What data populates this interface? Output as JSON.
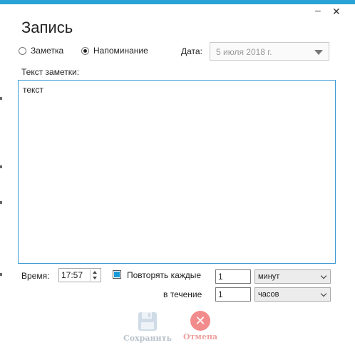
{
  "window": {
    "minimize_glyph": "–",
    "close_glyph": "✕"
  },
  "title": "Запись",
  "mode": {
    "note_label": "Заметка",
    "reminder_label": "Напоминание",
    "selected": "reminder"
  },
  "date": {
    "label": "Дата:",
    "value": "5 июля 2018 г."
  },
  "note": {
    "label": "Текст заметки:",
    "value": "текст"
  },
  "time": {
    "label": "Время:",
    "value": "17:57"
  },
  "repeat": {
    "checked": true,
    "label": "Повторять каждые",
    "every_value": "1",
    "every_unit": "минут",
    "during_label": "в течение",
    "during_value": "1",
    "during_unit": "часов"
  },
  "actions": {
    "save_label": "Сохранить",
    "cancel_label": "Отмена",
    "save_icon": "floppy-disk-icon",
    "cancel_icon": "close-circle-icon"
  },
  "colors": {
    "accent": "#29a3d6",
    "focus_border": "#3c9bd6",
    "checkbox_fill": "#1a9bd7",
    "cancel_red": "#f28b8b"
  }
}
